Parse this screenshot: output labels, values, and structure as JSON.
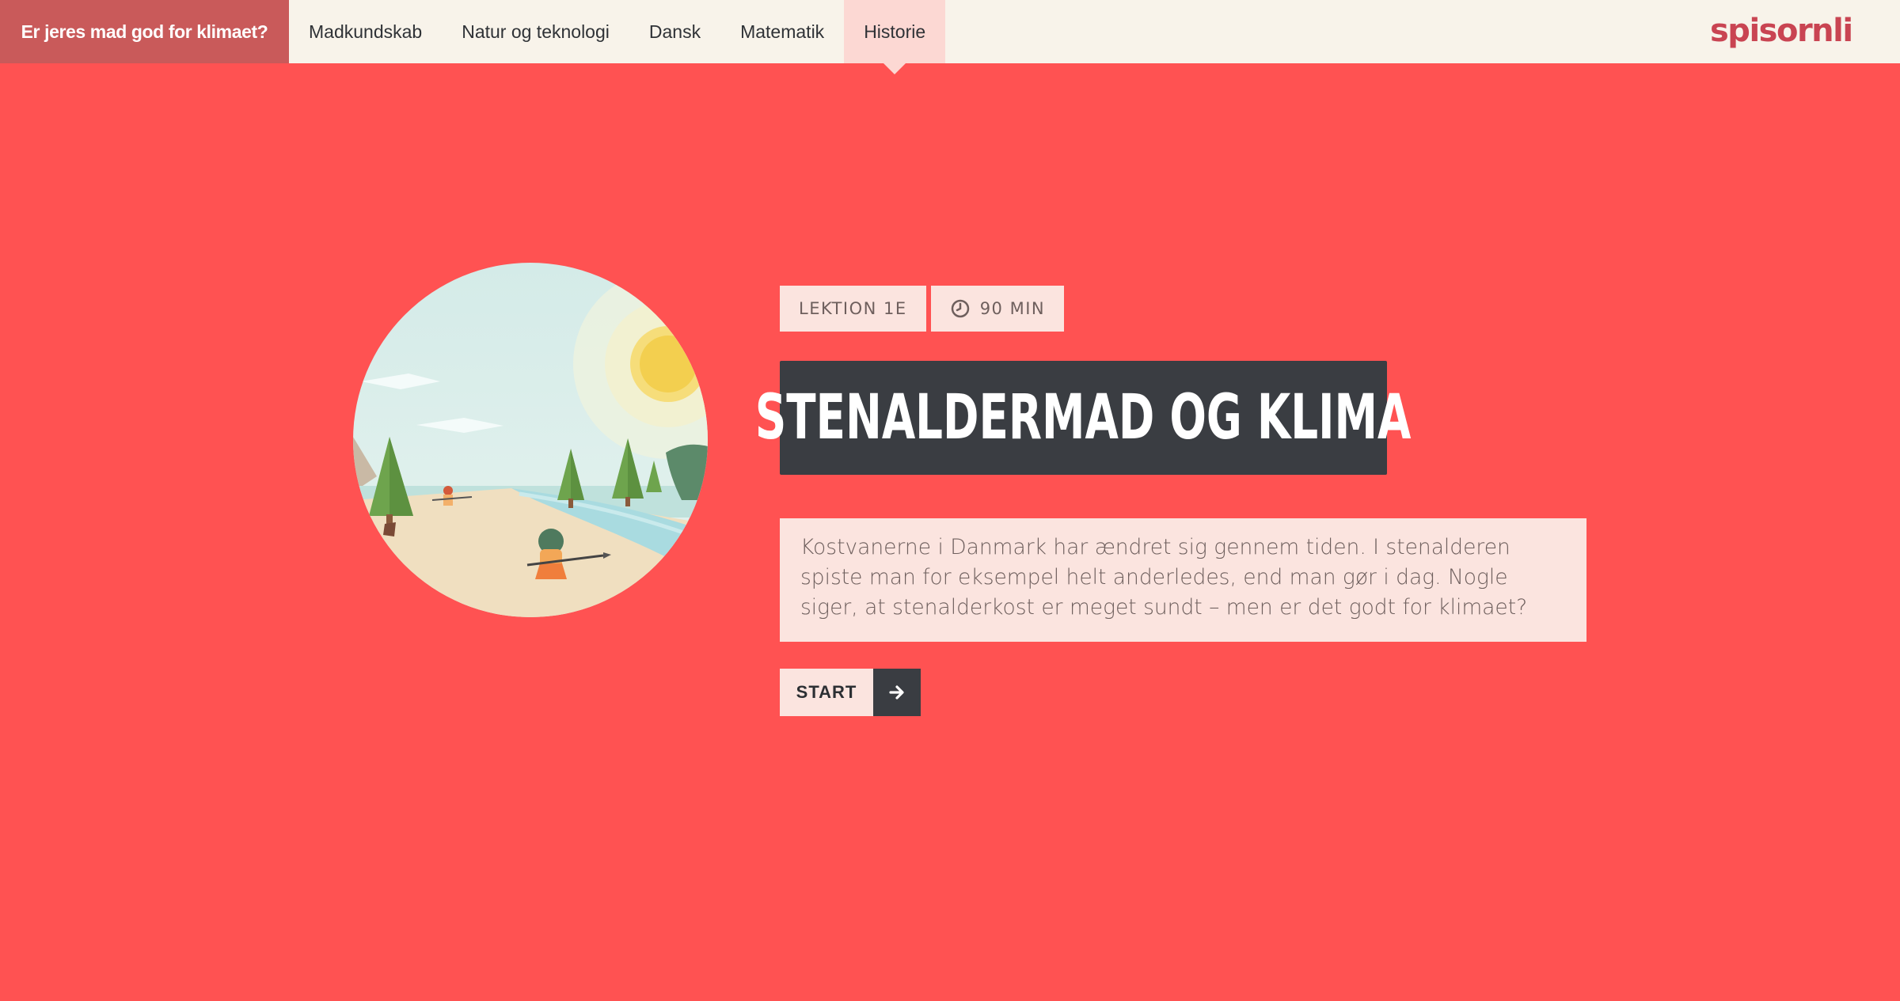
{
  "nav": {
    "brand": "Er jeres mad god for klimaet?",
    "tabs": [
      {
        "label": "Madkundskab",
        "active": false
      },
      {
        "label": "Natur og teknologi",
        "active": false
      },
      {
        "label": "Dansk",
        "active": false
      },
      {
        "label": "Matematik",
        "active": false
      },
      {
        "label": "Historie",
        "active": true
      }
    ],
    "logo_text": "spisornli"
  },
  "lesson": {
    "badge": "LEKTION 1E",
    "duration": "90 MIN",
    "title": "STENALDERMAD OG KLIMA",
    "description": "Kostvanerne i Danmark har ændret sig gennem tiden. I stenalderen spiste man for eksempel helt anderledes, end man gør i dag. Nogle siger, at stenalderkost er meget sundt – men er det godt for klimaet?",
    "start_label": "START"
  },
  "icons": {
    "clock": "clock-icon",
    "arrow": "arrow-right-icon"
  },
  "colors": {
    "background": "#ff5252",
    "nav_background": "#f8f3ea",
    "brand_tab": "#c95a5a",
    "active_tab": "#fcd8d3",
    "dark": "#3a3d42",
    "light_box": "#fbe4df",
    "logo": "#c94452"
  }
}
